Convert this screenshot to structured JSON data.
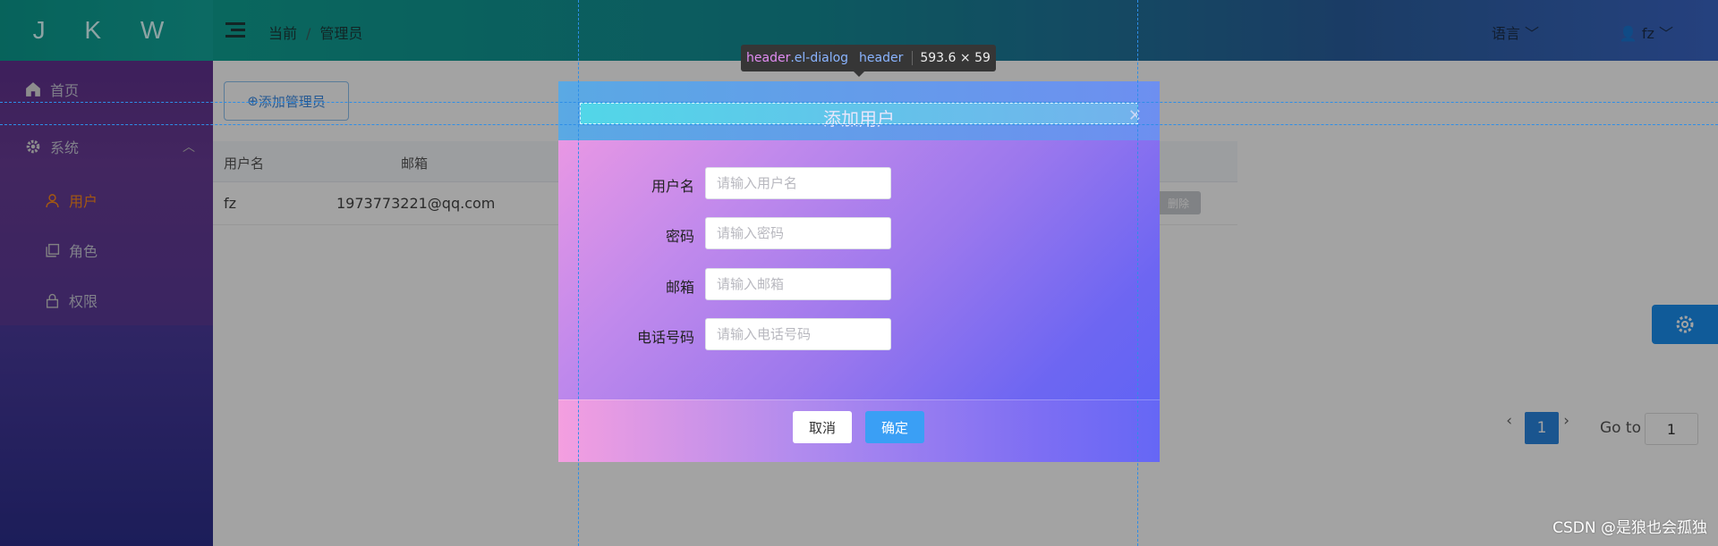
{
  "sidebar": {
    "logo": "J K W",
    "items": [
      {
        "label": "首页",
        "icon": "home-icon"
      },
      {
        "label": "系统",
        "icon": "gear-icon"
      },
      {
        "label": "用户",
        "icon": "user-icon",
        "active": true
      },
      {
        "label": "角色",
        "icon": "copy-icon"
      },
      {
        "label": "权限",
        "icon": "lock-icon"
      }
    ]
  },
  "header": {
    "breadcrumb": [
      "当前",
      "管理员"
    ],
    "language": "语言",
    "user": "fz"
  },
  "main": {
    "add_button": "添加管理员",
    "table": {
      "columns": [
        "用户名",
        "邮箱"
      ],
      "rows": [
        {
          "username": "fz",
          "email": "1973773221@qq.com",
          "delete": "删除"
        }
      ]
    },
    "pagination": {
      "prev": "‹",
      "current": "1",
      "next": "›",
      "goto_label": "Go to",
      "goto_value": "1"
    }
  },
  "dialog": {
    "title": "添加用户",
    "fields": [
      {
        "label": "用户名",
        "placeholder": "请输入用户名"
      },
      {
        "label": "密码",
        "placeholder": "请输入密码"
      },
      {
        "label": "邮箱",
        "placeholder": "请输入邮箱"
      },
      {
        "label": "电话号码",
        "placeholder": "请输入电话号码"
      }
    ],
    "cancel": "取消",
    "confirm": "确定"
  },
  "devtools": {
    "tag": "header",
    "class": ".el-dialog",
    "name": "header",
    "size": "593.6 × 59"
  },
  "watermark": "CSDN @是狼也会孤独",
  "colors": {
    "accent": "#3a9ff5",
    "active_menu": "#ff8a1c"
  }
}
